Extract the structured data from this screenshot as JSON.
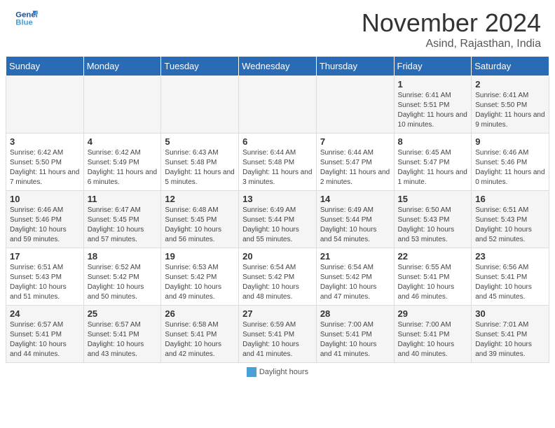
{
  "header": {
    "logo_line1": "General",
    "logo_line2": "Blue",
    "month_title": "November 2024",
    "subtitle": "Asind, Rajasthan, India"
  },
  "weekdays": [
    "Sunday",
    "Monday",
    "Tuesday",
    "Wednesday",
    "Thursday",
    "Friday",
    "Saturday"
  ],
  "weeks": [
    [
      {
        "day": "",
        "info": ""
      },
      {
        "day": "",
        "info": ""
      },
      {
        "day": "",
        "info": ""
      },
      {
        "day": "",
        "info": ""
      },
      {
        "day": "",
        "info": ""
      },
      {
        "day": "1",
        "info": "Sunrise: 6:41 AM\nSunset: 5:51 PM\nDaylight: 11 hours and 10 minutes."
      },
      {
        "day": "2",
        "info": "Sunrise: 6:41 AM\nSunset: 5:50 PM\nDaylight: 11 hours and 9 minutes."
      }
    ],
    [
      {
        "day": "3",
        "info": "Sunrise: 6:42 AM\nSunset: 5:50 PM\nDaylight: 11 hours and 7 minutes."
      },
      {
        "day": "4",
        "info": "Sunrise: 6:42 AM\nSunset: 5:49 PM\nDaylight: 11 hours and 6 minutes."
      },
      {
        "day": "5",
        "info": "Sunrise: 6:43 AM\nSunset: 5:48 PM\nDaylight: 11 hours and 5 minutes."
      },
      {
        "day": "6",
        "info": "Sunrise: 6:44 AM\nSunset: 5:48 PM\nDaylight: 11 hours and 3 minutes."
      },
      {
        "day": "7",
        "info": "Sunrise: 6:44 AM\nSunset: 5:47 PM\nDaylight: 11 hours and 2 minutes."
      },
      {
        "day": "8",
        "info": "Sunrise: 6:45 AM\nSunset: 5:47 PM\nDaylight: 11 hours and 1 minute."
      },
      {
        "day": "9",
        "info": "Sunrise: 6:46 AM\nSunset: 5:46 PM\nDaylight: 11 hours and 0 minutes."
      }
    ],
    [
      {
        "day": "10",
        "info": "Sunrise: 6:46 AM\nSunset: 5:46 PM\nDaylight: 10 hours and 59 minutes."
      },
      {
        "day": "11",
        "info": "Sunrise: 6:47 AM\nSunset: 5:45 PM\nDaylight: 10 hours and 57 minutes."
      },
      {
        "day": "12",
        "info": "Sunrise: 6:48 AM\nSunset: 5:45 PM\nDaylight: 10 hours and 56 minutes."
      },
      {
        "day": "13",
        "info": "Sunrise: 6:49 AM\nSunset: 5:44 PM\nDaylight: 10 hours and 55 minutes."
      },
      {
        "day": "14",
        "info": "Sunrise: 6:49 AM\nSunset: 5:44 PM\nDaylight: 10 hours and 54 minutes."
      },
      {
        "day": "15",
        "info": "Sunrise: 6:50 AM\nSunset: 5:43 PM\nDaylight: 10 hours and 53 minutes."
      },
      {
        "day": "16",
        "info": "Sunrise: 6:51 AM\nSunset: 5:43 PM\nDaylight: 10 hours and 52 minutes."
      }
    ],
    [
      {
        "day": "17",
        "info": "Sunrise: 6:51 AM\nSunset: 5:43 PM\nDaylight: 10 hours and 51 minutes."
      },
      {
        "day": "18",
        "info": "Sunrise: 6:52 AM\nSunset: 5:42 PM\nDaylight: 10 hours and 50 minutes."
      },
      {
        "day": "19",
        "info": "Sunrise: 6:53 AM\nSunset: 5:42 PM\nDaylight: 10 hours and 49 minutes."
      },
      {
        "day": "20",
        "info": "Sunrise: 6:54 AM\nSunset: 5:42 PM\nDaylight: 10 hours and 48 minutes."
      },
      {
        "day": "21",
        "info": "Sunrise: 6:54 AM\nSunset: 5:42 PM\nDaylight: 10 hours and 47 minutes."
      },
      {
        "day": "22",
        "info": "Sunrise: 6:55 AM\nSunset: 5:41 PM\nDaylight: 10 hours and 46 minutes."
      },
      {
        "day": "23",
        "info": "Sunrise: 6:56 AM\nSunset: 5:41 PM\nDaylight: 10 hours and 45 minutes."
      }
    ],
    [
      {
        "day": "24",
        "info": "Sunrise: 6:57 AM\nSunset: 5:41 PM\nDaylight: 10 hours and 44 minutes."
      },
      {
        "day": "25",
        "info": "Sunrise: 6:57 AM\nSunset: 5:41 PM\nDaylight: 10 hours and 43 minutes."
      },
      {
        "day": "26",
        "info": "Sunrise: 6:58 AM\nSunset: 5:41 PM\nDaylight: 10 hours and 42 minutes."
      },
      {
        "day": "27",
        "info": "Sunrise: 6:59 AM\nSunset: 5:41 PM\nDaylight: 10 hours and 41 minutes."
      },
      {
        "day": "28",
        "info": "Sunrise: 7:00 AM\nSunset: 5:41 PM\nDaylight: 10 hours and 41 minutes."
      },
      {
        "day": "29",
        "info": "Sunrise: 7:00 AM\nSunset: 5:41 PM\nDaylight: 10 hours and 40 minutes."
      },
      {
        "day": "30",
        "info": "Sunrise: 7:01 AM\nSunset: 5:41 PM\nDaylight: 10 hours and 39 minutes."
      }
    ]
  ],
  "legend": {
    "label": "Daylight hours"
  }
}
